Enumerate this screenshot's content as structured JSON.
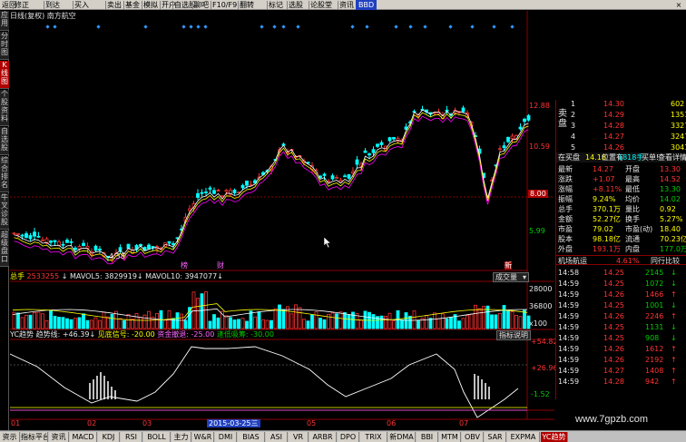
{
  "toolbar": {
    "items": [
      "返回",
      "修正",
      "到达",
      "买入",
      "卖出",
      "基金",
      "模拟",
      "开户",
      "自选股",
      "聊吧",
      "F10/F9",
      "翻转",
      "标记",
      "选股",
      "论股堂",
      "资讯"
    ],
    "badge": "BBD",
    "close": "×"
  },
  "left_tabs": [
    "应用",
    "分时图",
    "K线图",
    "个股资料",
    "自选股",
    "综合排名",
    "牛叉诊股",
    "超级盘口"
  ],
  "left_active": 2,
  "title": "日线(复权) 南方航空",
  "price_axis": {
    "labels": [
      "12.88",
      "10.59",
      "8.00",
      "5.99"
    ],
    "low_mark": "4.38",
    "markers": [
      "榜",
      "财",
      "新"
    ]
  },
  "volume": {
    "header": {
      "label": "总手",
      "total": "2533255",
      "ma5_label": "MAVOL5",
      "ma5": "3829919",
      "ma10_label": "MAVOL10",
      "ma10": "3947077"
    },
    "dropdown": "成交量",
    "axis": [
      "x100",
      "36800",
      "28000"
    ]
  },
  "indicator": {
    "header": {
      "name": "YC趋势",
      "trend_label": "趋势线",
      "trend": "+46.39",
      "signal_label": "见底信号",
      "signal": "-20.00",
      "warn_label": "资金撤退",
      "warn": "-25.00",
      "hold_label": "逢低吸筹",
      "hold": "-30.00"
    },
    "help": "指标说明",
    "axis": [
      "+54.82",
      "+26.96",
      "-1.52"
    ]
  },
  "date_axis": [
    "01",
    "02",
    "03",
    "2015-03-25三",
    "05",
    "06",
    "07"
  ],
  "quote": {
    "sell_label": "卖",
    "buy_label": "买",
    "pan_label": "盘",
    "book_prices": [
      "14.30",
      "14.29",
      "14.28",
      "14.27",
      "14.26"
    ],
    "book_vols": [
      "602",
      "1351",
      "3327",
      "3247",
      "3041"
    ],
    "book_index": [
      "1",
      "2",
      "3",
      "4",
      "5"
    ],
    "inner_outer": [
      "在买盘",
      "14.18",
      "位置有",
      "1818手",
      "买单!",
      "查看详情"
    ],
    "stats": [
      {
        "l1": "最新",
        "v1": "14.27",
        "l2": "开盘",
        "v2": "13.30"
      },
      {
        "l1": "涨跌",
        "v1": "+1.07",
        "l2": "最高",
        "v2": "14.52"
      },
      {
        "l1": "涨幅",
        "v1": "+8.11%",
        "l2": "最低",
        "v2": "13.30"
      },
      {
        "l1": "振幅",
        "v1": "9.24%",
        "l2": "均价",
        "v2": "14.02"
      },
      {
        "l1": "总手",
        "v1": "370.1万",
        "l2": "量比",
        "v2": "0.92"
      },
      {
        "l1": "金额",
        "v1": "52.27亿",
        "l2": "换手",
        "v2": "5.27%"
      },
      {
        "l1": "市盈",
        "v1": "79.02",
        "l2": "市盈(动)",
        "v2": "18.40"
      },
      {
        "l1": "股本",
        "v1": "98.18亿",
        "l2": "流通",
        "v2": "70.23亿"
      },
      {
        "l1": "外盘",
        "v1": "193.1万",
        "l2": "内盘",
        "v2": "177.0万"
      }
    ],
    "sector": {
      "name": "机场航运",
      "change": "4.61%",
      "compare": "同行比较"
    },
    "ticks": [
      {
        "t": "14:58",
        "p": "14.25",
        "v": "2145",
        "d": "down"
      },
      {
        "t": "14:59",
        "p": "14.25",
        "v": "1072",
        "d": "down"
      },
      {
        "t": "14:59",
        "p": "14.26",
        "v": "1466",
        "d": "up"
      },
      {
        "t": "14:59",
        "p": "14.25",
        "v": "1001",
        "d": "down"
      },
      {
        "t": "14:59",
        "p": "14.26",
        "v": "2246",
        "d": "up"
      },
      {
        "t": "14:59",
        "p": "14.25",
        "v": "1131",
        "d": "down"
      },
      {
        "t": "14:59",
        "p": "14.25",
        "v": "908",
        "d": "down"
      },
      {
        "t": "14:59",
        "p": "14.26",
        "v": "1612",
        "d": "up"
      },
      {
        "t": "14:59",
        "p": "14.26",
        "v": "2192",
        "d": "up"
      },
      {
        "t": "14:59",
        "p": "14.27",
        "v": "1408",
        "d": "up"
      },
      {
        "t": "14:59",
        "p": "14.28",
        "v": "942",
        "d": "up"
      }
    ]
  },
  "bottom_tabs": [
    "资示",
    "指标平台",
    "资讯",
    "MACD",
    "KDJ",
    "RSI",
    "BOLL",
    "主力",
    "W&R",
    "DMI",
    "BIAS",
    "ASI",
    "VR",
    "ARBR",
    "DPO",
    "TRIX",
    "新DMA",
    "BBI",
    "MTM",
    "OBV",
    "SAR",
    "EXPMA",
    "YC趋势"
  ],
  "bottom_active": 22,
  "watermark": "www.7gpzb.com",
  "colors": {
    "up": "#ff3333",
    "down": "#00ffff",
    "ma5": "#ffffff",
    "ma10": "#ffff00",
    "ma20": "#ff00ff",
    "accent": "#b00000"
  }
}
